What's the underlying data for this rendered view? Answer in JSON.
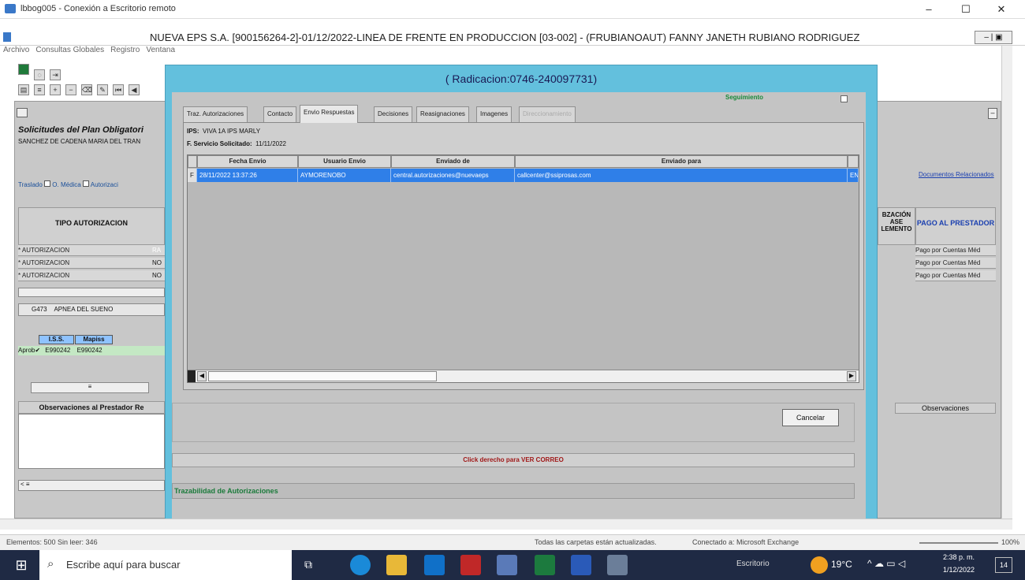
{
  "rd_window": {
    "title": "lbbog005 - Conexión a Escritorio remoto"
  },
  "forms_window": {
    "title": "NUEVA EPS S.A. [900156264-2]-01/12/2022-LINEA DE FRENTE EN PRODUCCION [03-002] - (FRUBIANOAUT)    FANNY JANETH RUBIANO RODRIGUEZ"
  },
  "menu": [
    "Archivo",
    "Consultas Globales",
    "Registro",
    "Ventana"
  ],
  "background": {
    "form_title": "Solicitudes del Plan Obligatori",
    "patient": "SANCHEZ DE CADENA MARIA DEL TRAN",
    "checkboxes": [
      "Traslado",
      "O. Médica",
      "Autorizaci"
    ],
    "col_tipo": "TIPO AUTORIZACION",
    "rows": [
      "* AUTORIZACION",
      "* AUTORIZACION",
      "* AUTORIZACION"
    ],
    "row_codes": [
      "RA",
      "NO",
      "NO"
    ],
    "dx_code": "G473",
    "dx_name": "APNEA DEL SUENO",
    "mini_headers": [
      "I.S.S.",
      "Mapiss"
    ],
    "mini_row": [
      "Aprob",
      "E990242",
      "E990242"
    ],
    "observaciones_prestador": "Observaciones al Prestador Re",
    "right_col1": "BZACIÓN ASE LEMENTO",
    "right_col2": "PAGO AL PRESTADOR",
    "right_rows": [
      "Pago por Cuentas Méd",
      "Pago por Cuentas Méd",
      "Pago por Cuentas Méd"
    ],
    "docs_link": "Documentos Relacionados",
    "observaciones": "Observaciones"
  },
  "modal": {
    "title": "( Radicacion:0746-240097731)",
    "seguimiento": "Seguimiento",
    "tabs": [
      "Traz. Autorizaciones",
      "Contacto",
      "Envio Respuestas",
      "Decisiones",
      "Reasignaciones",
      "Imagenes",
      "Direccionamiento"
    ],
    "ips_label": "IPS:",
    "ips_value": "VIVA 1A IPS MARLY",
    "servicio_label": "F. Servicio Solicitado:",
    "servicio_value": "11/11/2022",
    "grid_headers": [
      "Fecha Envio",
      "Usuario Envio",
      "Enviado de",
      "Enviado para"
    ],
    "grid_row": [
      "28/11/2022 13:37:26",
      "AYMORENOBO",
      "central.autorizaciones@nuevaeps",
      "callcenter@ssiprosas.com",
      "EN"
    ],
    "cancel_label": "Cancelar",
    "hint": "Click derecho para VER CORREO",
    "footer_label": "Trazabilidad de Autorizaciones"
  },
  "statusline": {
    "left": "Elementos: 500    Sin leer: 346",
    "mid": "Todas las carpetas están actualizadas.",
    "conn": "Conectado a: Microsoft Exchange",
    "zoom": "100%"
  },
  "taskbar": {
    "search_placeholder": "Escribe aquí para buscar",
    "desktop": "Escritorio",
    "temp": "19°C",
    "time": "2:38 p. m.",
    "date": "1/12/2022",
    "notif": "14"
  }
}
